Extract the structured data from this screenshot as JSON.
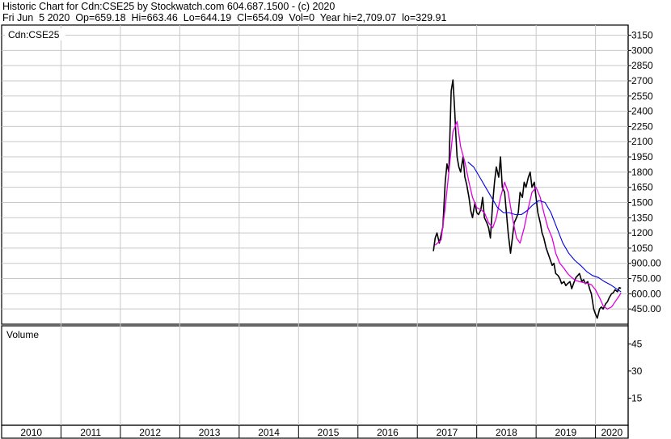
{
  "header": {
    "line1": "Historic Chart for Cdn:CSE25 by Stockwatch.com 604.687.1500 - (c) 2020",
    "line2": "Fri Jun  5 2020  Op=659.18  Hi=663.46  Lo=644.19  Cl=654.09  Vol=0  Year hi=2,709.07  lo=329.91"
  },
  "price_panel": {
    "label": "Cdn:CSE25"
  },
  "volume_panel": {
    "label": "Volume"
  },
  "colors": {
    "price": "#000000",
    "ma_short": "#e000e0",
    "ma_long": "#0000e0",
    "grid": "#c8c8c8",
    "frame": "#000000"
  },
  "chart_data": [
    {
      "type": "line",
      "title": "Cdn:CSE25",
      "ylim": [
        300,
        3250
      ],
      "y_ticks": [
        "3150",
        "3000",
        "2850",
        "2700",
        "2550",
        "2400",
        "2250",
        "2100",
        "1950",
        "1800",
        "1650",
        "1500",
        "1350",
        "1200",
        "1050",
        "900.00",
        "750.00",
        "600.00",
        "450.00"
      ],
      "x_ticks": [
        "2010",
        "2011",
        "2012",
        "2013",
        "2014",
        "2015",
        "2016",
        "2017",
        "2018",
        "2019",
        "2020"
      ],
      "xlim": [
        2010.0,
        2020.55
      ],
      "grid": true,
      "series": [
        {
          "x": [
            2017.27,
            2017.3,
            2017.33,
            2017.37,
            2017.4,
            2017.43,
            2017.47,
            2017.5,
            2017.53,
            2017.57,
            2017.6,
            2017.63,
            2017.65,
            2017.67,
            2017.7,
            2017.73,
            2017.77,
            2017.8,
            2017.83,
            2017.87,
            2017.9,
            2017.93,
            2017.97,
            2018.0,
            2018.03,
            2018.07,
            2018.1,
            2018.13,
            2018.17,
            2018.2,
            2018.23,
            2018.27,
            2018.3,
            2018.33,
            2018.37,
            2018.4,
            2018.43,
            2018.47,
            2018.5,
            2018.53,
            2018.57,
            2018.6,
            2018.63,
            2018.67,
            2018.7,
            2018.73,
            2018.77,
            2018.8,
            2018.83,
            2018.87,
            2018.9,
            2018.93,
            2018.97,
            2019.0,
            2019.03,
            2019.07,
            2019.1,
            2019.13,
            2019.17,
            2019.2,
            2019.23,
            2019.27,
            2019.3,
            2019.33,
            2019.37,
            2019.4,
            2019.43,
            2019.47,
            2019.5,
            2019.53,
            2019.57,
            2019.6,
            2019.63,
            2019.67,
            2019.7,
            2019.73,
            2019.77,
            2019.8,
            2019.83,
            2019.87,
            2019.9,
            2019.93,
            2019.97,
            2020.0,
            2020.03,
            2020.07,
            2020.1,
            2020.13,
            2020.17,
            2020.2,
            2020.23,
            2020.27,
            2020.3,
            2020.33,
            2020.37,
            2020.4,
            2020.43
          ],
          "values": [
            1020,
            1150,
            1200,
            1100,
            1180,
            1260,
            1700,
            1880,
            1800,
            2600,
            2709,
            2400,
            2150,
            1950,
            1850,
            1800,
            1950,
            1750,
            1680,
            1550,
            1420,
            1350,
            1500,
            1400,
            1380,
            1430,
            1550,
            1350,
            1300,
            1250,
            1150,
            1500,
            1700,
            1850,
            1750,
            1950,
            1650,
            1600,
            1400,
            1200,
            1000,
            1150,
            1300,
            1350,
            1400,
            1600,
            1550,
            1700,
            1650,
            1750,
            1800,
            1650,
            1700,
            1550,
            1400,
            1300,
            1200,
            1150,
            1050,
            1000,
            950,
            880,
            900,
            800,
            780,
            750,
            700,
            720,
            680,
            700,
            720,
            650,
            700,
            760,
            780,
            800,
            720,
            740,
            700,
            720,
            650,
            600,
            450,
            400,
            360,
            450,
            470,
            450,
            500,
            520,
            560,
            600,
            610,
            640,
            620,
            660,
            654
          ],
          "name": ""
        },
        {
          "x": [
            2017.3,
            2017.4,
            2017.47,
            2017.53,
            2017.6,
            2017.67,
            2017.73,
            2017.8,
            2017.87,
            2017.93,
            2018.0,
            2018.07,
            2018.13,
            2018.2,
            2018.27,
            2018.33,
            2018.4,
            2018.47,
            2018.53,
            2018.6,
            2018.67,
            2018.73,
            2018.8,
            2018.87,
            2018.93,
            2019.0,
            2019.07,
            2019.13,
            2019.2,
            2019.27,
            2019.33,
            2019.4,
            2019.47,
            2019.53,
            2019.6,
            2019.67,
            2019.73,
            2019.8,
            2019.87,
            2019.93,
            2020.0,
            2020.07,
            2020.13,
            2020.2,
            2020.27,
            2020.33,
            2020.4,
            2020.43
          ],
          "values": [
            1080,
            1130,
            1450,
            1800,
            2200,
            2300,
            2050,
            1900,
            1700,
            1550,
            1450,
            1430,
            1400,
            1300,
            1250,
            1350,
            1550,
            1700,
            1600,
            1350,
            1150,
            1100,
            1250,
            1450,
            1600,
            1650,
            1550,
            1400,
            1250,
            1150,
            1000,
            900,
            850,
            800,
            760,
            730,
            720,
            710,
            700,
            690,
            640,
            560,
            480,
            450,
            470,
            520,
            580,
            610
          ],
          "name": ""
        },
        {
          "x": [
            2017.85,
            2017.95,
            2018.05,
            2018.15,
            2018.25,
            2018.35,
            2018.45,
            2018.55,
            2018.65,
            2018.75,
            2018.85,
            2018.95,
            2019.05,
            2019.15,
            2019.25,
            2019.35,
            2019.45,
            2019.55,
            2019.65,
            2019.75,
            2019.85,
            2019.95,
            2020.05,
            2020.15,
            2020.25,
            2020.35,
            2020.43
          ],
          "values": [
            1900,
            1850,
            1750,
            1650,
            1550,
            1450,
            1400,
            1400,
            1380,
            1380,
            1420,
            1480,
            1520,
            1500,
            1400,
            1250,
            1100,
            1000,
            930,
            880,
            820,
            780,
            760,
            720,
            690,
            650,
            620
          ],
          "name": ""
        }
      ]
    },
    {
      "type": "bar",
      "title": "Volume",
      "y_ticks": [
        "45",
        "30",
        "15"
      ],
      "ylim": [
        0,
        55
      ],
      "values": []
    }
  ]
}
